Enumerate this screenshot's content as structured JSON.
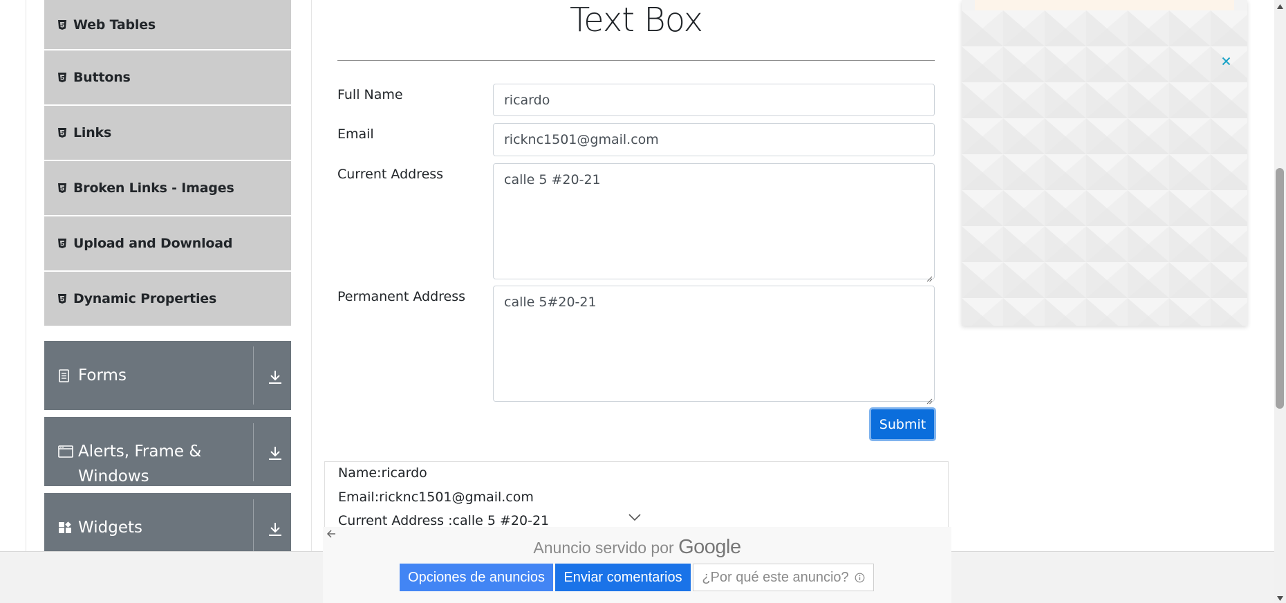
{
  "sidebar": {
    "elements_items": [
      {
        "label": "Web Tables",
        "icon": "html5-icon"
      },
      {
        "label": "Buttons",
        "icon": "html5-icon"
      },
      {
        "label": "Links",
        "icon": "html5-icon"
      },
      {
        "label": "Broken Links - Images",
        "icon": "html5-icon"
      },
      {
        "label": "Upload and Download",
        "icon": "html5-icon"
      },
      {
        "label": "Dynamic Properties",
        "icon": "html5-icon"
      }
    ],
    "groups": [
      {
        "label": "Forms",
        "icon": "document-icon"
      },
      {
        "label": "Alerts, Frame & Windows",
        "icon": "window-icon"
      },
      {
        "label": "Widgets",
        "icon": "widgets-icon"
      }
    ]
  },
  "main": {
    "title": "Text Box",
    "form": {
      "full_name_label": "Full Name",
      "full_name_value": "ricardo",
      "email_label": "Email",
      "email_value": "ricknc1501@gmail.com",
      "current_address_label": "Current Address",
      "current_address_value": "calle 5 #20-21",
      "permanent_address_label": "Permanent Address",
      "permanent_address_value": "calle 5#20-21",
      "submit_label": "Submit"
    },
    "output": {
      "name": "Name:ricardo",
      "email": "Email:ricknc1501@gmail.com",
      "current_address": "Current Address :calle 5 #20-21"
    }
  },
  "ad": {
    "close_icon": "close-icon",
    "served_by_prefix": "Anuncio servido por",
    "served_by_brand": "Google",
    "options_label": "Opciones de anuncios",
    "feedback_label": "Enviar comentarios",
    "why_label": "¿Por qué este anuncio?"
  },
  "colors": {
    "sidebar_item_bg": "#cccccc",
    "group_bg": "#6c757d",
    "submit_bg": "#0b6edc",
    "ad_btn_blue": "#4285f4",
    "ad_close": "#1aa3c7"
  }
}
